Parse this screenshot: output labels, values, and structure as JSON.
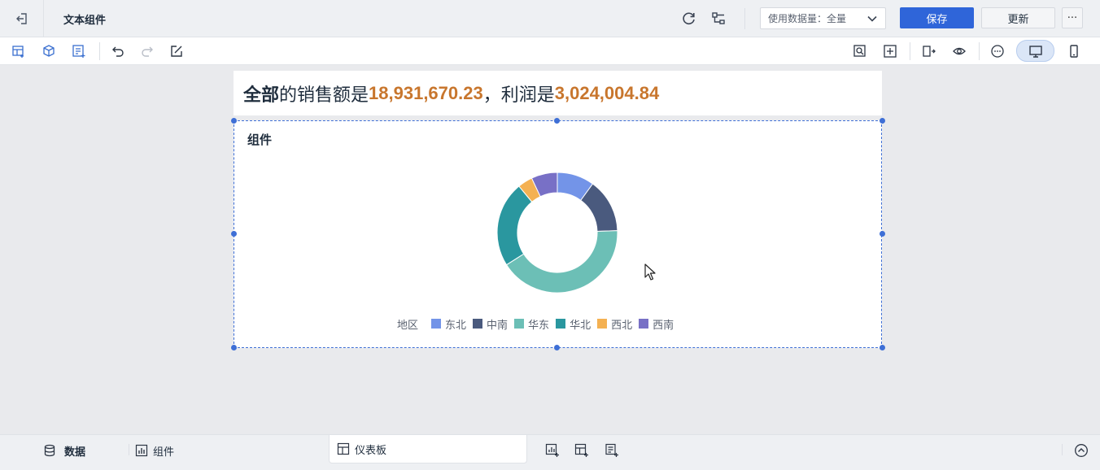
{
  "app": {
    "title": "文本组件"
  },
  "header": {
    "data_select_label": "使用数据量：",
    "data_select_value": "全量",
    "save_label": "保存",
    "update_label": "更新",
    "more_label": "···"
  },
  "banner": {
    "prefix": "全部",
    "text1": " 的销售额是",
    "sales": "18,931,670.23",
    "text2": "，利润是",
    "profit": "3,024,004.84"
  },
  "widget": {
    "title": "组件"
  },
  "chart_data": {
    "type": "pie",
    "donut": true,
    "legend_title": "地区",
    "legend_position": "bottom",
    "categories": [
      "东北",
      "中南",
      "华东",
      "华北",
      "西北",
      "西南"
    ],
    "values": [
      10.0,
      14.5,
      41.5,
      23.0,
      4.0,
      7.0
    ],
    "colors": [
      "#7394e8",
      "#4a5a7e",
      "#6cbfb6",
      "#2a979f",
      "#f4b152",
      "#7870c6"
    ]
  },
  "bottom": {
    "data_label": "数据",
    "component_label": "组件",
    "dashboard_label": "仪表板"
  },
  "colors": {
    "accent": "#2f65d9",
    "highlight": "#c8762d",
    "selection": "#3e6fd6"
  }
}
